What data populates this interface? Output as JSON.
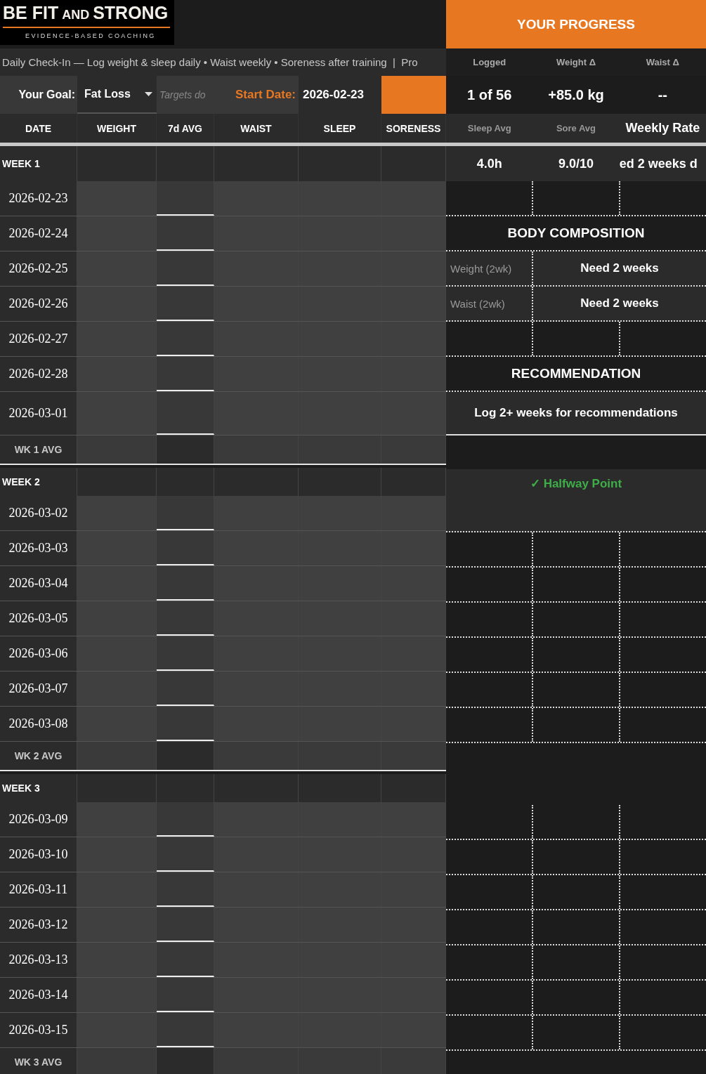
{
  "brand": {
    "title": [
      {
        "text": "BE FIT",
        "small": false
      },
      {
        "text": "AND",
        "small": true
      },
      {
        "text": "STRONG",
        "small": false
      }
    ],
    "tagline": "EVIDENCE-BASED COACHING"
  },
  "instructions": "Daily Check-In — Log weight & sleep daily • Waist weekly • Soreness after training  |  Pro",
  "goal": {
    "label": "Your Goal:",
    "value": "Fat Loss",
    "placeholder": "Targets do",
    "start_label": "Start Date:",
    "start_value": "2026-02-23"
  },
  "columns": [
    "DATE",
    "WEIGHT",
    "7d AVG",
    "WAIST",
    "SLEEP",
    "SORENESS"
  ],
  "weeks": [
    {
      "label": "WEEK 1",
      "days": [
        "2026-02-23",
        "2026-02-24",
        "2026-02-25",
        "2026-02-26",
        "2026-02-27",
        "2026-02-28",
        "2026-03-01"
      ],
      "avg_label": "WK 1 AVG"
    },
    {
      "label": "WEEK 2",
      "days": [
        "2026-03-02",
        "2026-03-03",
        "2026-03-04",
        "2026-03-05",
        "2026-03-06",
        "2026-03-07",
        "2026-03-08"
      ],
      "avg_label": "WK 2 AVG"
    },
    {
      "label": "WEEK 3",
      "days": [
        "2026-03-09",
        "2026-03-10",
        "2026-03-11",
        "2026-03-12",
        "2026-03-13",
        "2026-03-14",
        "2026-03-15"
      ],
      "avg_label": "WK 3 AVG"
    }
  ],
  "progress": {
    "title": "YOUR PROGRESS",
    "stats": [
      {
        "label": "Logged",
        "value": "1 of 56"
      },
      {
        "label": "Weight Δ",
        "value": "+85.0 kg"
      },
      {
        "label": "Waist Δ",
        "value": "--"
      }
    ],
    "stats2": [
      {
        "label": "Sleep Avg",
        "value": "4.0h",
        "emphasis": false
      },
      {
        "label": "Sore Avg",
        "value": "9.0/10",
        "emphasis": false
      },
      {
        "label": "Weekly Rate",
        "value": "ed 2 weeks d",
        "emphasis": true
      }
    ],
    "body_composition": {
      "title": "BODY COMPOSITION",
      "rows": [
        {
          "label": "Weight (2wk)",
          "value": "Need 2 weeks"
        },
        {
          "label": "Waist (2wk)",
          "value": "Need 2 weeks"
        }
      ]
    },
    "recommendation": {
      "title": "RECOMMENDATION",
      "text": "Log 2+ weeks for recommendations"
    },
    "milestone": "✓ Halfway Point"
  }
}
